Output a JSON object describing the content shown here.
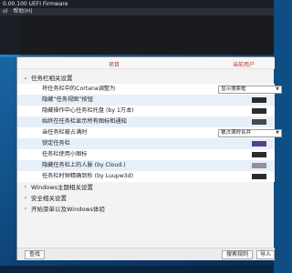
{
  "window": {
    "title": "0.00.100 UEFI Firmware",
    "menu": [
      "ol",
      "帮助(H)"
    ]
  },
  "header": {
    "col_item": "项目",
    "col_value": "当前用户"
  },
  "groups": {
    "taskbar_label": "任务栏相关设置",
    "windows_theme_label": "Windows主题相关设置",
    "security_label": "安全相关设置",
    "start_menu_label": "开始菜单以及Windows体验"
  },
  "items": [
    {
      "label": "将任务栏中的Cortana调整为",
      "value": "显示搜索框"
    },
    {
      "label": "隐藏“任务视图”按钮"
    },
    {
      "label": "隐藏操作中心任务栏托盘 (by 1万本)"
    },
    {
      "label": "始终在任务栏显示所有图标和通知"
    },
    {
      "label": "当任务栏被占满时",
      "value": "被占满时合并"
    },
    {
      "label": "锁定任务栏"
    },
    {
      "label": "任务栏使用小图标"
    },
    {
      "label": "隐藏任务栏上的人脉 (by Cloud.)"
    },
    {
      "label": "任务栏时钟精确到秒 (by Luupw3d)"
    }
  ],
  "footer": {
    "find_label": "查找",
    "search_label": "搜索规则",
    "import_label": "导入"
  },
  "colors": {
    "accent_red": "#b23a3a",
    "swatch_purple": "#5b3f8c"
  }
}
